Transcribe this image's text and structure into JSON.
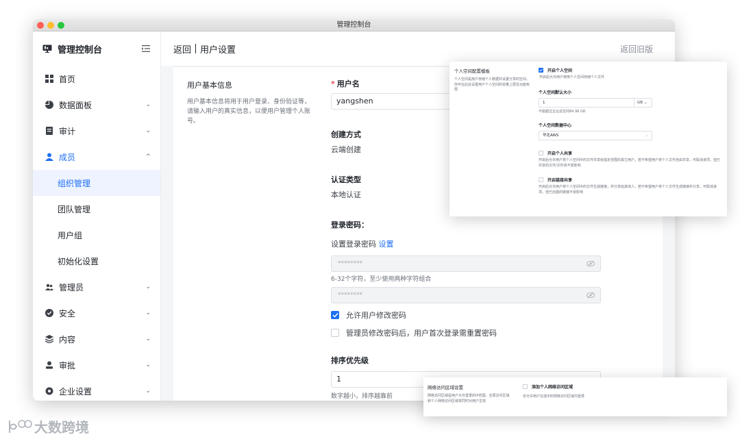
{
  "window": {
    "title": "管理控制台"
  },
  "sidebar": {
    "brand": "管理控制台",
    "items": [
      {
        "label": "首页",
        "icon": "grid-icon",
        "chevron": ""
      },
      {
        "label": "数据面板",
        "icon": "pie-chart-icon",
        "chevron": "⌄"
      },
      {
        "label": "审计",
        "icon": "document-icon",
        "chevron": "⌄"
      },
      {
        "label": "成员",
        "icon": "person-icon",
        "chevron": "^"
      },
      {
        "label": "管理员",
        "icon": "people-icon",
        "chevron": "⌄"
      },
      {
        "label": "安全",
        "icon": "shield-check-icon",
        "chevron": "⌄"
      },
      {
        "label": "内容",
        "icon": "layers-icon",
        "chevron": "⌄"
      },
      {
        "label": "审批",
        "icon": "user-approve-icon",
        "chevron": "⌄"
      },
      {
        "label": "企业设置",
        "icon": "gear-icon",
        "chevron": "⌄"
      }
    ],
    "subitems": [
      "组织管理",
      "团队管理",
      "用户组",
      "初始化设置"
    ]
  },
  "header": {
    "back": "返回",
    "title": "用户设置",
    "old_version": "返回旧版"
  },
  "section": {
    "title": "用户基本信息",
    "description": "用户基本信息将用于用户登录、身份验证等，请输入用户的真实信息，以便用户管理个人账号。"
  },
  "form": {
    "username_label": "用户名",
    "username_value": "yangshen",
    "create_label": "创建方式",
    "create_value": "云端创建",
    "auth_label": "认证类型",
    "auth_value": "本地认证",
    "password_label": "登录密码：",
    "password_set_text": "设置登录密码",
    "password_set_link": "设置",
    "password_mask": "********",
    "password_hint": "6-32个字符，至少使用两种字符组合",
    "password_confirm_mask": "********",
    "allow_change": "允许用户修改密码",
    "force_reset": "管理员修改密码后，用户首次登录需重置密码",
    "priority_label": "排序优先级",
    "priority_value": "1",
    "priority_hint": "数字越小，排序越靠前"
  },
  "card1": {
    "title": "个人空间配置模板",
    "desc": "个人空间是用户存储个人数据并设置分享的空间。你可在此处设置用户个人空间的容量上限及功能权限",
    "enable": "开启个人空间",
    "enable_desc": "开启后允许用户使用个人空间存储个人文件",
    "size_label": "个人空间默认大小",
    "size_value": "1",
    "size_unit": "GB",
    "size_hint": "不能超过企业总空间84.96 GB",
    "center_label": "个人空间数据中心",
    "center_value": "华北AWS",
    "share": "开启个人共享",
    "share_desc": "开启后允许用户将个人空间中的文件共享给指定范围的其它用户，若不希望用户将个人文件自由共享，可取消该项，但已共享的文件/文件夹不受影响",
    "link_share": "开启链接共享",
    "link_share_desc": "开启后允许用户将个人空间中的文件生成链接，并分享给其他人，若不希望用户将个人文件生成链接并分享，可取消该项，但已创建的链接不受影响"
  },
  "card2": {
    "title": "网络访问区域设置",
    "desc": "网络访问区域是用户允许登录的IP范围。全局访问区域和个人网络访问区域将同时对用户生效",
    "add": "添加个人网络访问区域",
    "add_desc": "仅允许用户在选中的网络访问区域内登录"
  },
  "watermark": {
    "text": "大数跨境"
  },
  "colors": {
    "accent": "#1d6ff3",
    "required": "#e34d59"
  }
}
